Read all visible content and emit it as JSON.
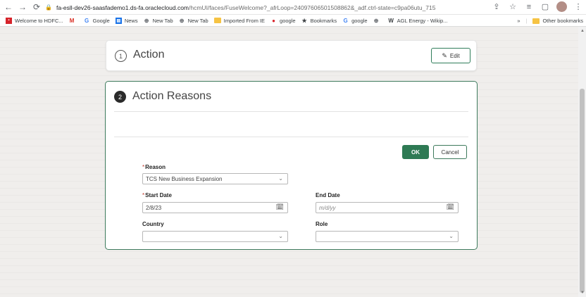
{
  "browser": {
    "url_host": "fa-esll-dev26-saasfademo1.ds-fa.oraclecloud.com",
    "url_path": "/hcmUI/faces/FuseWelcome?_afrLoop=24097606501508862&_adf.ctrl-state=c9pa06utu_715",
    "bookmarks": [
      {
        "label": "Welcome to HDFC...",
        "icon": "hdfc-icon",
        "color": "#d6232a"
      },
      {
        "label": "",
        "icon": "gmail-icon",
        "color": "#d93025"
      },
      {
        "label": "Google",
        "icon": "google-icon",
        "color": "#4285f4"
      },
      {
        "label": "News",
        "icon": "news-icon",
        "color": "#1a73e8"
      },
      {
        "label": "New Tab",
        "icon": "globe-icon",
        "color": "#5f6368"
      },
      {
        "label": "New Tab",
        "icon": "globe-icon",
        "color": "#5f6368"
      },
      {
        "label": "Imported From IE",
        "icon": "folder-icon",
        "color": "#f6c343"
      },
      {
        "label": "google",
        "icon": "opera-icon",
        "color": "#d8232a"
      },
      {
        "label": "Bookmarks",
        "icon": "star-icon",
        "color": "#3c4043"
      },
      {
        "label": "google",
        "icon": "google-icon",
        "color": "#4285f4"
      },
      {
        "label": "",
        "icon": "globe-icon",
        "color": "#5f6368"
      },
      {
        "label": "AGL Energy - Wikip...",
        "icon": "wikipedia-icon",
        "color": "#3c4043"
      }
    ],
    "overflow_label": "»",
    "other_bookmarks": "Other bookmarks"
  },
  "action_card": {
    "step": "1",
    "title": "Action",
    "edit_label": "Edit"
  },
  "reasons_card": {
    "step": "2",
    "title": "Action Reasons",
    "ok_label": "OK",
    "cancel_label": "Cancel",
    "reason": {
      "label": "Reason",
      "required": "*",
      "value": "TCS New Business Expansion"
    },
    "start_date": {
      "label": "Start Date",
      "required": "*",
      "value": "2/8/23"
    },
    "end_date": {
      "label": "End Date",
      "placeholder": "m/d/yy"
    },
    "country": {
      "label": "Country",
      "value": ""
    },
    "role": {
      "label": "Role",
      "value": ""
    }
  },
  "colors": {
    "accent_green": "#2e7a54",
    "card_border": "#3d7a5c"
  }
}
